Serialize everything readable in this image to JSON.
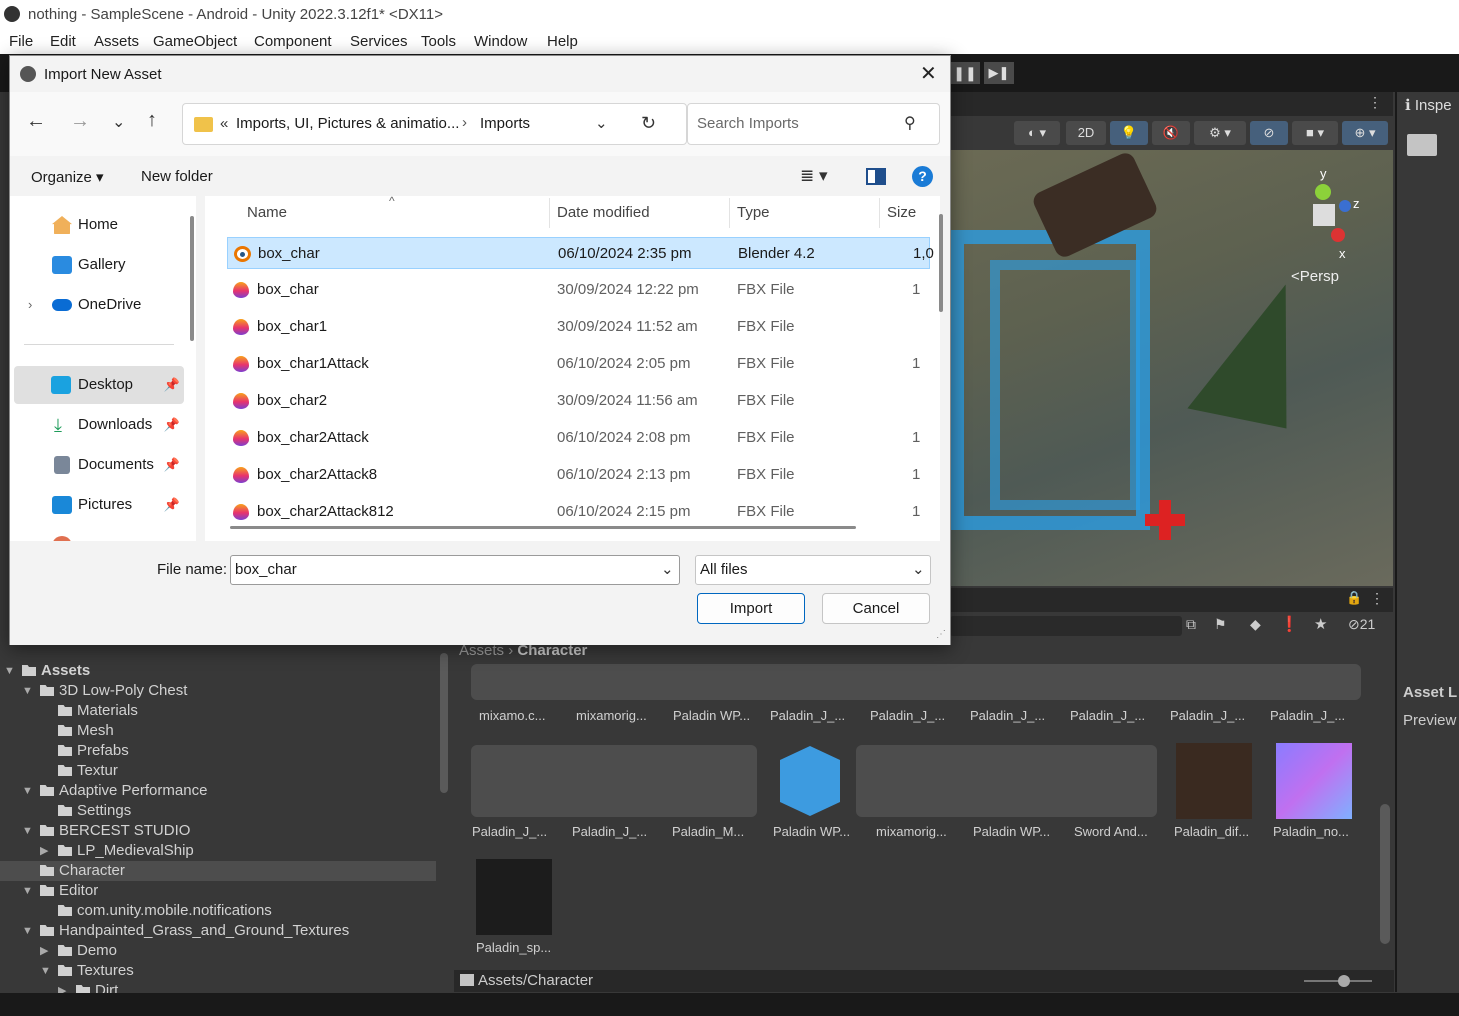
{
  "window": {
    "title": "nothing - SampleScene - Android - Unity 2022.3.12f1* <DX11>"
  },
  "menu": [
    "File",
    "Edit",
    "Assets",
    "GameObject",
    "Component",
    "Services",
    "Tools",
    "Window",
    "Help"
  ],
  "scene": {
    "tools": {
      "mode_2d": "2D"
    },
    "gizmo": {
      "persp": "<Persp",
      "axis_y": "y",
      "axis_z": "z",
      "axis_x": "x"
    }
  },
  "inspector": {
    "tab": "Inspe",
    "asset_label": "Asset L",
    "preview": "Preview"
  },
  "project": {
    "breadcrumb_root": "Assets",
    "breadcrumb_current": "Character",
    "hidden_count": "21",
    "path": "Assets/Character",
    "row1_labels": [
      "mixamo.c...",
      "mixamorig...",
      "Paladin WP...",
      "Paladin_J_...",
      "Paladin_J_...",
      "Paladin_J_...",
      "Paladin_J_...",
      "Paladin_J_...",
      "Paladin_J_..."
    ],
    "row2_labels": [
      "Paladin_J_...",
      "Paladin_J_...",
      "Paladin_M...",
      "Paladin WP...",
      "mixamorig...",
      "Paladin WP...",
      "Sword And...",
      "Paladin_dif...",
      "Paladin_no..."
    ],
    "row3_labels": [
      "Paladin_sp..."
    ]
  },
  "hierarchy": [
    {
      "label": "Assets",
      "depth": 0,
      "expanded": true
    },
    {
      "label": "3D Low-Poly Chest",
      "depth": 1,
      "expanded": true
    },
    {
      "label": "Materials",
      "depth": 2,
      "expanded": false
    },
    {
      "label": "Mesh",
      "depth": 2,
      "expanded": false
    },
    {
      "label": "Prefabs",
      "depth": 2,
      "expanded": false
    },
    {
      "label": "Textur",
      "depth": 2,
      "expanded": false
    },
    {
      "label": "Adaptive Performance",
      "depth": 1,
      "expanded": true
    },
    {
      "label": "Settings",
      "depth": 2,
      "expanded": false
    },
    {
      "label": "BERCEST STUDIO",
      "depth": 1,
      "expanded": true
    },
    {
      "label": "LP_MedievalShip",
      "depth": 2,
      "expanded": false
    },
    {
      "label": "Character",
      "depth": 1,
      "expanded": false
    },
    {
      "label": "Editor",
      "depth": 1,
      "expanded": true
    },
    {
      "label": "com.unity.mobile.notifications",
      "depth": 2,
      "expanded": false
    },
    {
      "label": "Handpainted_Grass_and_Ground_Textures",
      "depth": 1,
      "expanded": true
    },
    {
      "label": "Demo",
      "depth": 2,
      "expanded": false
    },
    {
      "label": "Textures",
      "depth": 2,
      "expanded": true
    },
    {
      "label": "Dirt",
      "depth": 3,
      "expanded": false
    }
  ],
  "dialog": {
    "title": "Import New Asset",
    "address": {
      "prefix": "«",
      "parent": "Imports, UI, Pictures & animatio...",
      "current": "Imports"
    },
    "search_placeholder": "Search Imports",
    "organize": "Organize",
    "new_folder": "New folder",
    "nav": [
      {
        "label": "Home",
        "pinned": false
      },
      {
        "label": "Gallery",
        "pinned": false
      },
      {
        "label": "OneDrive",
        "pinned": false
      },
      {
        "label": "Desktop",
        "pinned": true
      },
      {
        "label": "Downloads",
        "pinned": true
      },
      {
        "label": "Documents",
        "pinned": true
      },
      {
        "label": "Pictures",
        "pinned": true
      }
    ],
    "columns": {
      "name": "Name",
      "date": "Date modified",
      "type": "Type",
      "size": "Size"
    },
    "files": [
      {
        "name": "box_char",
        "date": "06/10/2024 2:35 pm",
        "type": "Blender 4.2",
        "size": "1,0",
        "icon": "blender",
        "selected": true
      },
      {
        "name": "box_char",
        "date": "30/09/2024 12:22 pm",
        "type": "FBX File",
        "size": "1",
        "icon": "fbx",
        "selected": false
      },
      {
        "name": "box_char1",
        "date": "30/09/2024 11:52 am",
        "type": "FBX File",
        "size": "",
        "icon": "fbx",
        "selected": false
      },
      {
        "name": "box_char1Attack",
        "date": "06/10/2024 2:05 pm",
        "type": "FBX File",
        "size": "1",
        "icon": "fbx",
        "selected": false
      },
      {
        "name": "box_char2",
        "date": "30/09/2024 11:56 am",
        "type": "FBX File",
        "size": "",
        "icon": "fbx",
        "selected": false
      },
      {
        "name": "box_char2Attack",
        "date": "06/10/2024 2:08 pm",
        "type": "FBX File",
        "size": "1",
        "icon": "fbx",
        "selected": false
      },
      {
        "name": "box_char2Attack8",
        "date": "06/10/2024 2:13 pm",
        "type": "FBX File",
        "size": "1",
        "icon": "fbx",
        "selected": false
      },
      {
        "name": "box_char2Attack812",
        "date": "06/10/2024 2:15 pm",
        "type": "FBX File",
        "size": "1",
        "icon": "fbx",
        "selected": false
      }
    ],
    "file_name_label": "File name:",
    "file_name_value": "box_char",
    "file_type": "All files",
    "import_button": "Import",
    "cancel_button": "Cancel"
  }
}
